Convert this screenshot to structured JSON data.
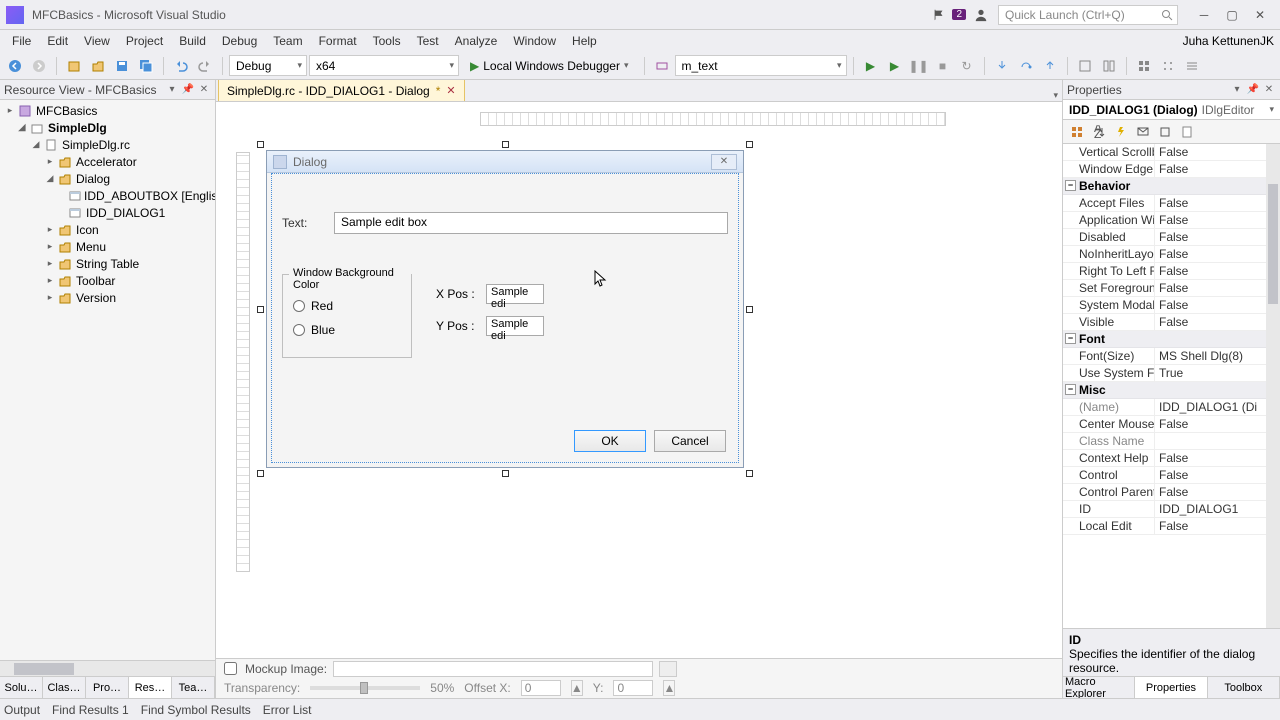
{
  "titlebar": {
    "title": "MFCBasics - Microsoft Visual Studio",
    "notification_count": "2",
    "quick_launch_placeholder": "Quick Launch (Ctrl+Q)",
    "user_name": "Juha Kettunen",
    "user_initials": "JK"
  },
  "menu": [
    "File",
    "Edit",
    "View",
    "Project",
    "Build",
    "Debug",
    "Team",
    "Format",
    "Tools",
    "Test",
    "Analyze",
    "Window",
    "Help"
  ],
  "toolbar": {
    "config": "Debug",
    "platform": "x64",
    "debugger": "Local Windows Debugger",
    "member": "m_text"
  },
  "left_panel": {
    "header": "Resource View - MFCBasics",
    "tree": {
      "root": "MFCBasics",
      "project": "SimpleDlg",
      "rc": "SimpleDlg.rc",
      "folders": [
        {
          "name": "Accelerator",
          "expanded": false
        },
        {
          "name": "Dialog",
          "expanded": true,
          "items": [
            "IDD_ABOUTBOX [English]",
            "IDD_DIALOG1"
          ]
        },
        {
          "name": "Icon",
          "expanded": false
        },
        {
          "name": "Menu",
          "expanded": false
        },
        {
          "name": "String Table",
          "expanded": false
        },
        {
          "name": "Toolbar",
          "expanded": false
        },
        {
          "name": "Version",
          "expanded": false
        }
      ]
    },
    "tabs": [
      "Solu…",
      "Clas…",
      "Pro…",
      "Res…",
      "Tea…"
    ],
    "active_tab": 3
  },
  "doc_tab": {
    "label": "SimpleDlg.rc - IDD_DIALOG1 - Dialog",
    "modified": "*"
  },
  "dialog": {
    "title": "Dialog",
    "text_label": "Text:",
    "text_value": "Sample edit box",
    "group_title": "Window Background Color",
    "radio_red": "Red",
    "radio_blue": "Blue",
    "xpos_label": "X Pos :",
    "ypos_label": "Y Pos :",
    "xpos_value": "Sample edi",
    "ypos_value": "Sample edi",
    "ok": "OK",
    "cancel": "Cancel"
  },
  "mockup": {
    "label": "Mockup Image:",
    "trans_label": "Transparency:",
    "trans_value": "50%",
    "offx_label": "Offset X:",
    "offx_value": "0",
    "offy_label": "Y:",
    "offy_value": "0"
  },
  "properties": {
    "header": "Properties",
    "selector_name": "IDD_DIALOG1 (Dialog)",
    "selector_type": "IDlgEditor",
    "rows_pre": [
      {
        "n": "Vertical Scrollba",
        "v": "False"
      },
      {
        "n": "Window Edge",
        "v": "False"
      }
    ],
    "cat_behavior": "Behavior",
    "rows_behavior": [
      {
        "n": "Accept Files",
        "v": "False"
      },
      {
        "n": "Application Win",
        "v": "False"
      },
      {
        "n": "Disabled",
        "v": "False"
      },
      {
        "n": "NoInheritLayou",
        "v": "False"
      },
      {
        "n": "Right To Left Re",
        "v": "False"
      },
      {
        "n": "Set Foreground",
        "v": "False"
      },
      {
        "n": "System Modal",
        "v": "False"
      },
      {
        "n": "Visible",
        "v": "False"
      }
    ],
    "cat_font": "Font",
    "rows_font": [
      {
        "n": "Font(Size)",
        "v": "MS Shell Dlg(8)"
      },
      {
        "n": "Use System Fon",
        "v": "True"
      }
    ],
    "cat_misc": "Misc",
    "rows_misc": [
      {
        "n": "(Name)",
        "v": "IDD_DIALOG1 (Di",
        "dim": true
      },
      {
        "n": "Center Mouse",
        "v": "False"
      },
      {
        "n": "Class Name",
        "v": "",
        "dim": true
      },
      {
        "n": "Context Help",
        "v": "False"
      },
      {
        "n": "Control",
        "v": "False"
      },
      {
        "n": "Control Parent",
        "v": "False"
      },
      {
        "n": "ID",
        "v": "IDD_DIALOG1"
      },
      {
        "n": "Local Edit",
        "v": "False"
      }
    ],
    "desc_name": "ID",
    "desc_text": "Specifies the identifier of the dialog resource.",
    "tabs": [
      "Macro Explorer",
      "Properties",
      "Toolbox"
    ],
    "active_tab": 1
  },
  "bottom_tabs": [
    "Output",
    "Find Results 1",
    "Find Symbol Results",
    "Error List"
  ]
}
